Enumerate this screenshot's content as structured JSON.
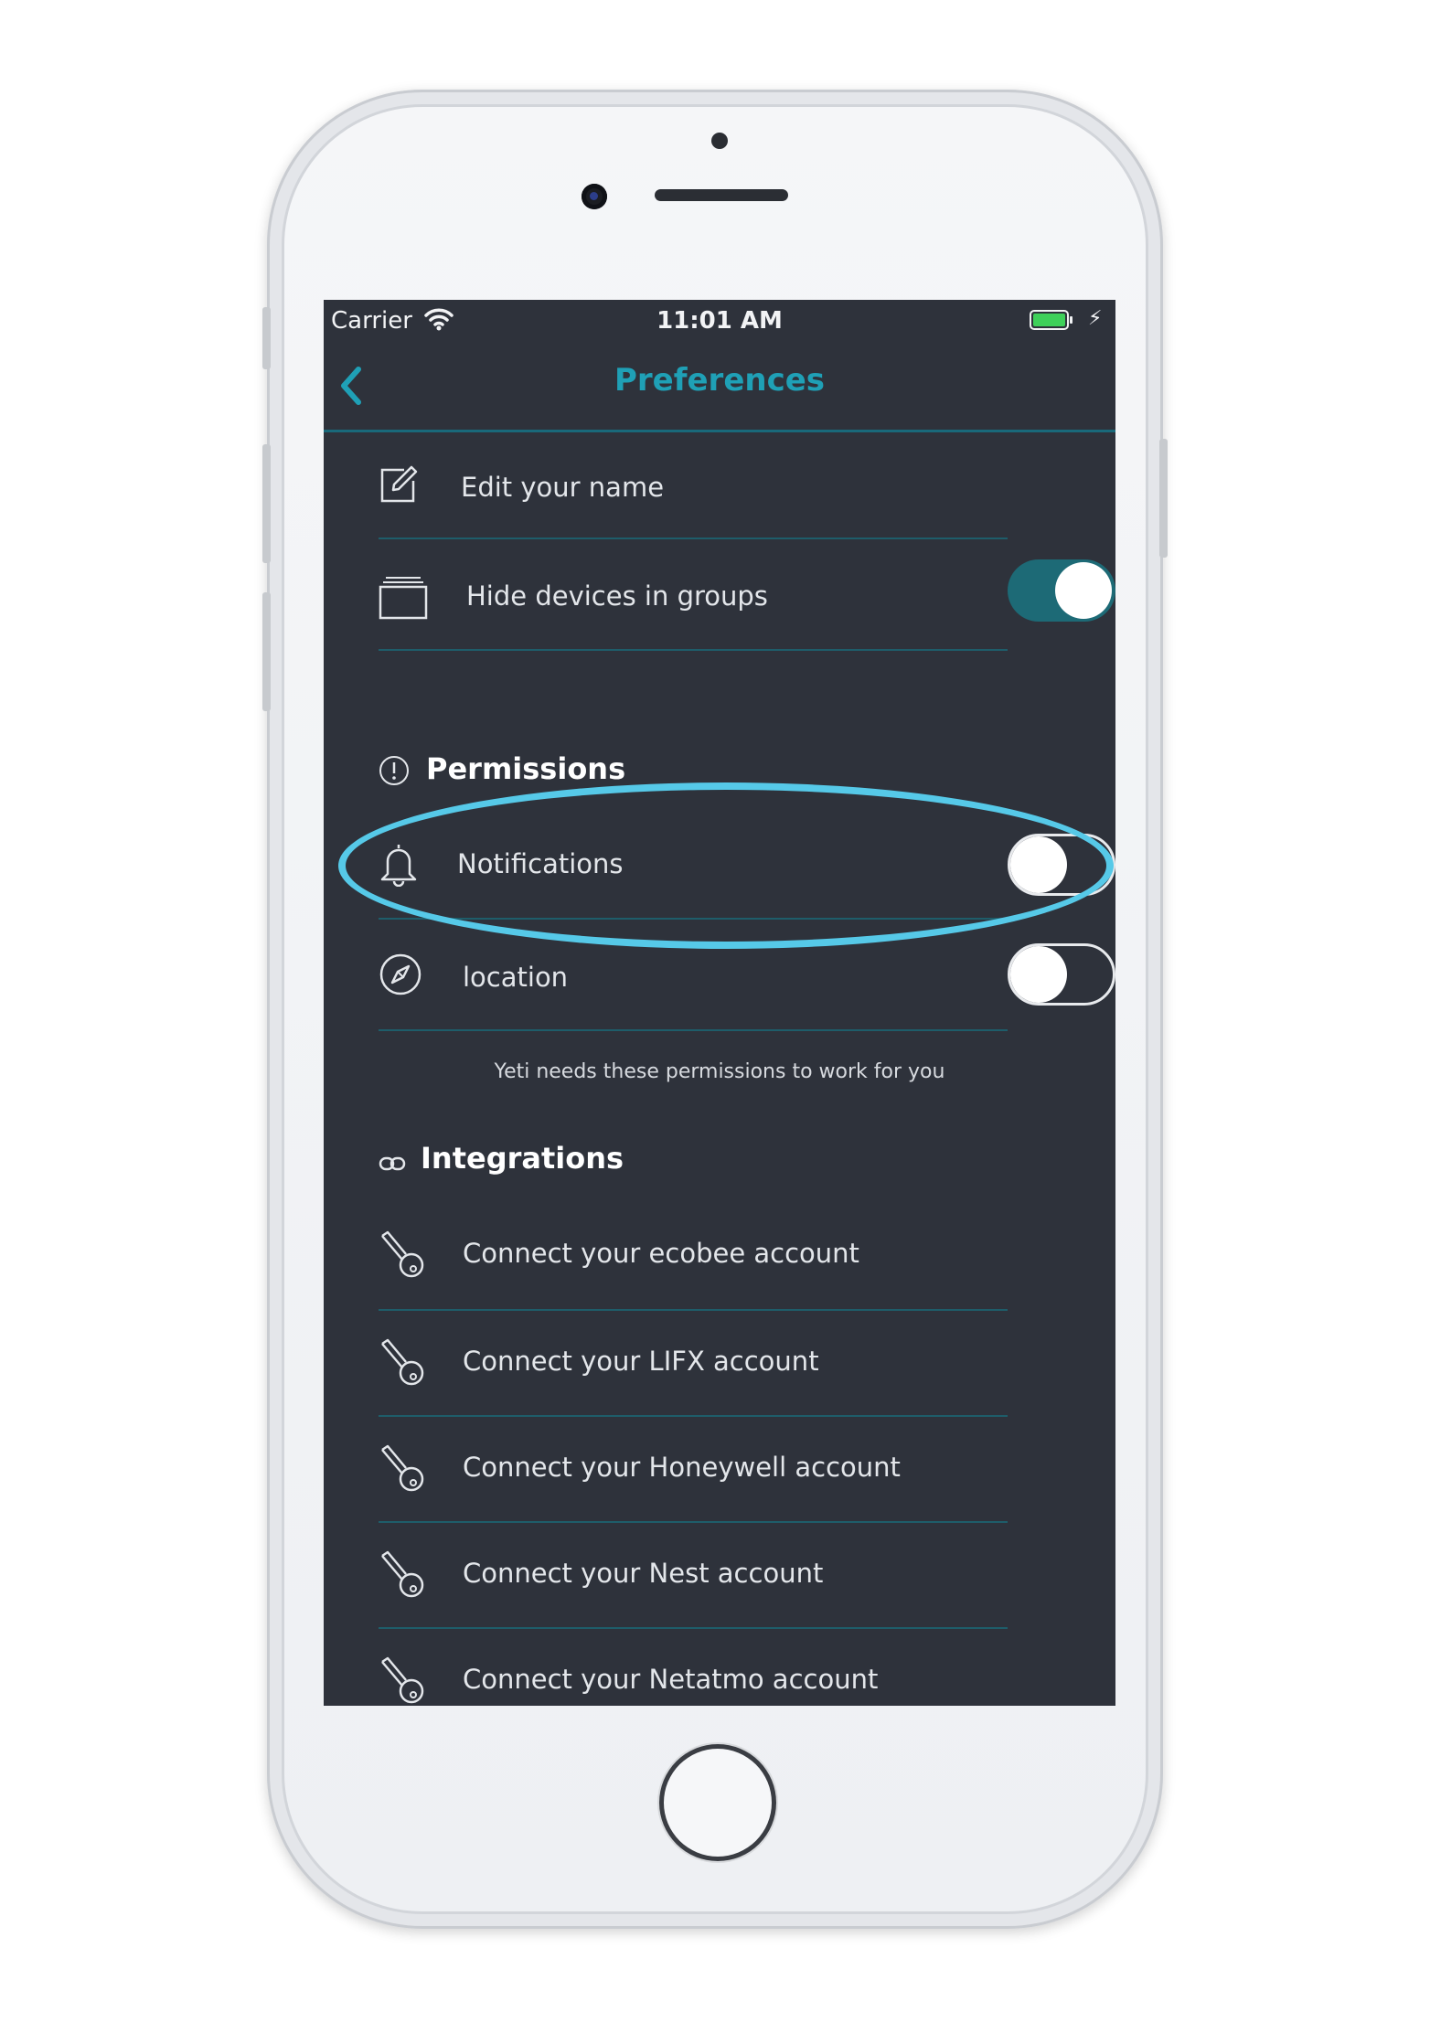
{
  "status_bar": {
    "carrier": "Carrier",
    "time": "11:01 AM"
  },
  "nav": {
    "title": "Preferences",
    "back_icon": "chevron-left-icon"
  },
  "general": {
    "edit_name": {
      "label": "Edit your name",
      "icon": "edit-icon"
    },
    "hide_devices": {
      "label": "Hide devices in groups",
      "icon": "folder-icon",
      "enabled": true
    }
  },
  "permissions": {
    "title": "Permissions",
    "icon": "info-circle-icon",
    "items": [
      {
        "label": "Notifications",
        "icon": "bell-icon",
        "enabled": false
      },
      {
        "label": "location",
        "icon": "compass-icon",
        "enabled": false
      }
    ],
    "hint": "Yeti needs these permissions to work for you"
  },
  "integrations": {
    "title": "Integrations",
    "icon": "link-icon",
    "items": [
      {
        "label": "Connect your ecobee account",
        "icon": "key-icon"
      },
      {
        "label": "Connect your LIFX account",
        "icon": "key-icon"
      },
      {
        "label": "Connect your Honeywell account",
        "icon": "key-icon"
      },
      {
        "label": "Connect your Nest account",
        "icon": "key-icon"
      },
      {
        "label": "Connect your Netatmo account",
        "icon": "key-icon"
      }
    ]
  },
  "colors": {
    "accent": "#1fa0b6",
    "background": "#2e323b",
    "highlight": "#56c9e8",
    "toggle_on": "#1d6a76"
  }
}
